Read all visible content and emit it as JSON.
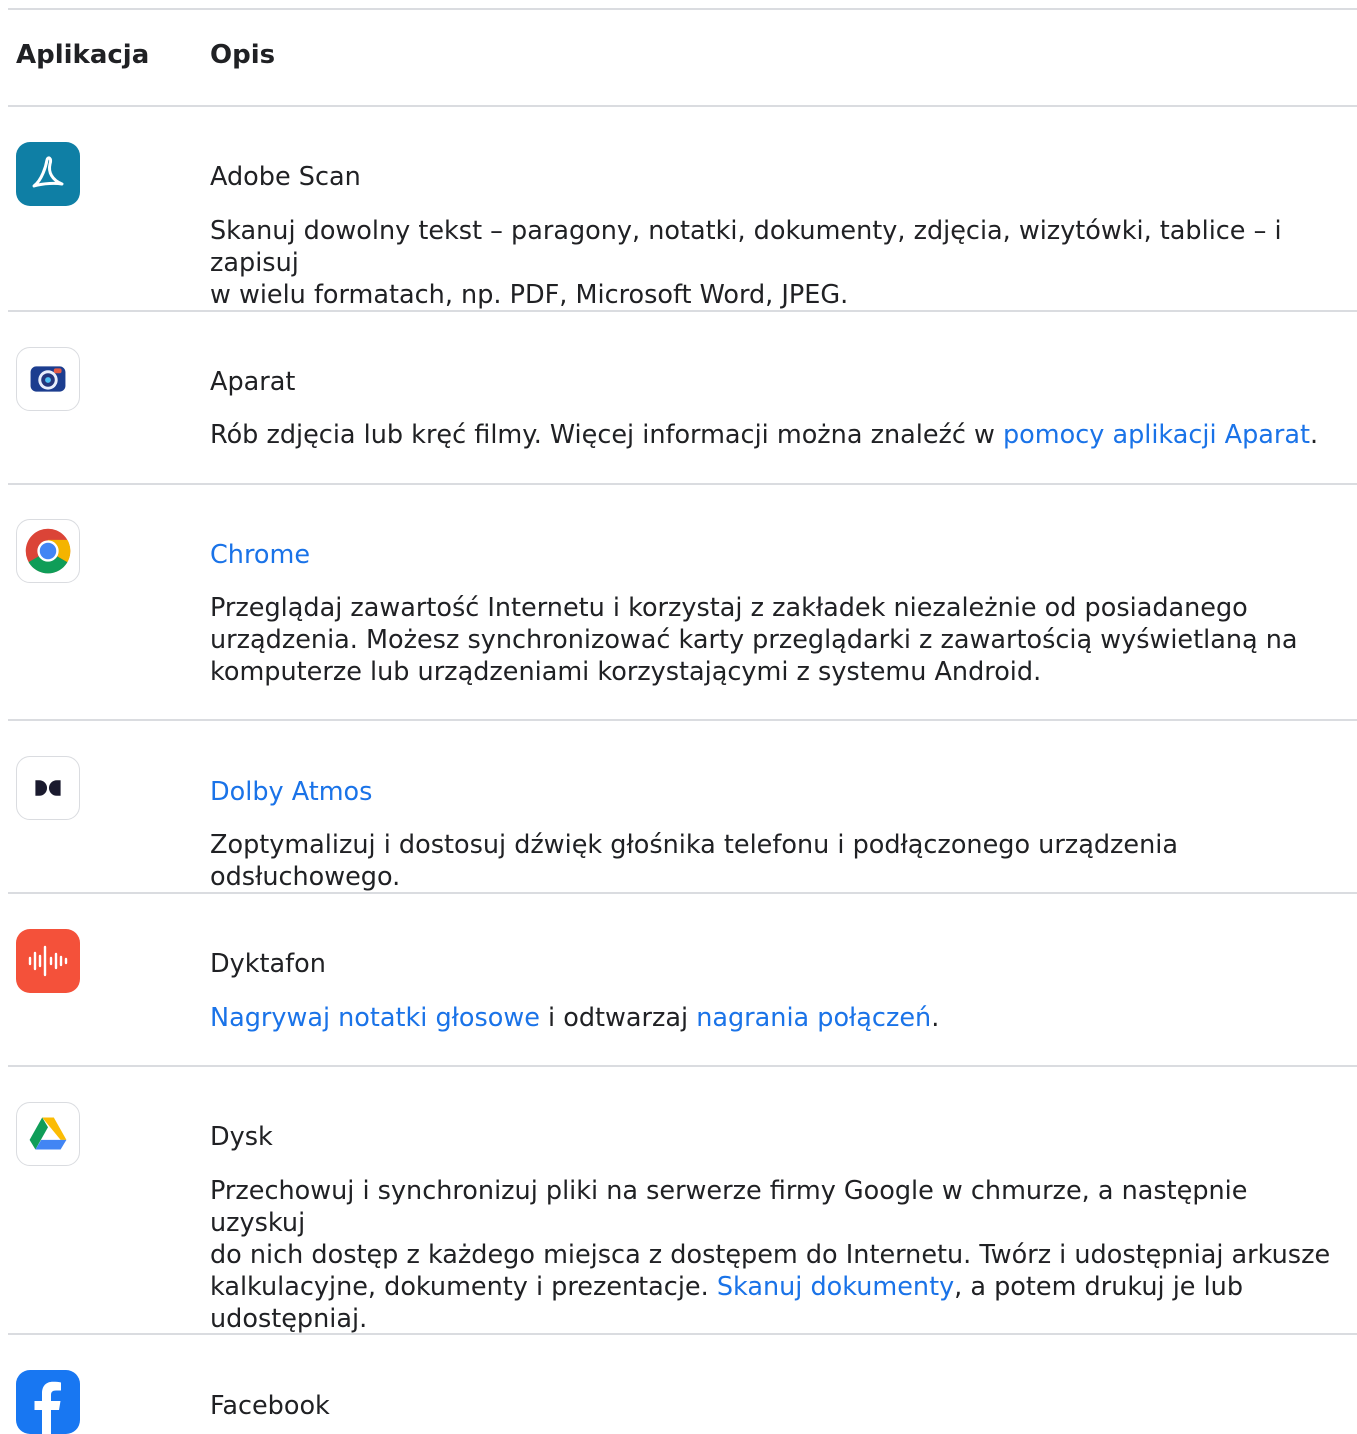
{
  "header": {
    "col_app": "Aplikacja",
    "col_desc": "Opis"
  },
  "apps": [
    {
      "name": "Adobe Scan",
      "icon": "adobe-scan-icon",
      "desc": [
        "Skanuj dowolny tekst – paragony, notatki, dokumenty, zdjęcia, wizytówki, tablice – i zapisuj",
        "w wielu formatach, np. PDF, Microsoft Word, JPEG."
      ]
    },
    {
      "name": "Aparat",
      "icon": "camera-icon",
      "desc_pre": "Rób zdjęcia lub kręć filmy. Więcej informacji można znaleźć w ",
      "desc_link": "pomocy aplikacji Aparat",
      "desc_post": "."
    },
    {
      "name": "Chrome",
      "icon": "chrome-icon",
      "desc": [
        "Przeglądaj zawartość Internetu i korzystaj z zakładek niezależnie od posiadanego",
        "urządzenia. Możesz synchronizować karty przeglądarki z zawartością wyświetlaną na",
        "komputerze lub urządzeniami korzystającymi z systemu Android."
      ]
    },
    {
      "name": "Dolby Atmos",
      "icon": "dolby-icon",
      "desc": [
        "Zoptymalizuj i dostosuj dźwięk głośnika telefonu i podłączonego urządzenia odsłuchowego."
      ]
    },
    {
      "name": "Dyktafon",
      "icon": "recorder-icon",
      "desc_link1": "Nagrywaj notatki głosowe",
      "desc_mid": " i odtwarzaj ",
      "desc_link2": "nagrania połączeń",
      "desc_post": "."
    },
    {
      "name": "Dysk",
      "icon": "drive-icon",
      "desc_lines": [
        "Przechowuj i synchronizuj pliki na serwerze firmy Google w chmurze, a następnie uzyskuj",
        "do nich dostęp z każdego miejsca z dostępem do Internetu. Twórz i udostępniaj arkusze"
      ],
      "desc_pre": "kalkulacyjne, dokumenty i prezentacje. ",
      "desc_link": "Skanuj dokumenty",
      "desc_post": ", a potem drukuj je lub",
      "desc_last": "udostępniaj."
    },
    {
      "name": "Facebook",
      "icon": "facebook-icon"
    }
  ],
  "colors": {
    "link": "#1a73e8",
    "rule": "#dadce0",
    "text": "#202124"
  }
}
